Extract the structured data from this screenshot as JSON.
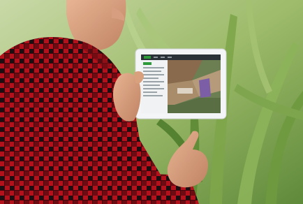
{
  "scene": {
    "subject": "farmer-with-tablet",
    "tablet_app": {
      "accent_color": "#2e9b3a",
      "map_colors": [
        "#8a6a4c",
        "#6b7f52",
        "#b59b7a",
        "#7b5ea6"
      ]
    }
  }
}
